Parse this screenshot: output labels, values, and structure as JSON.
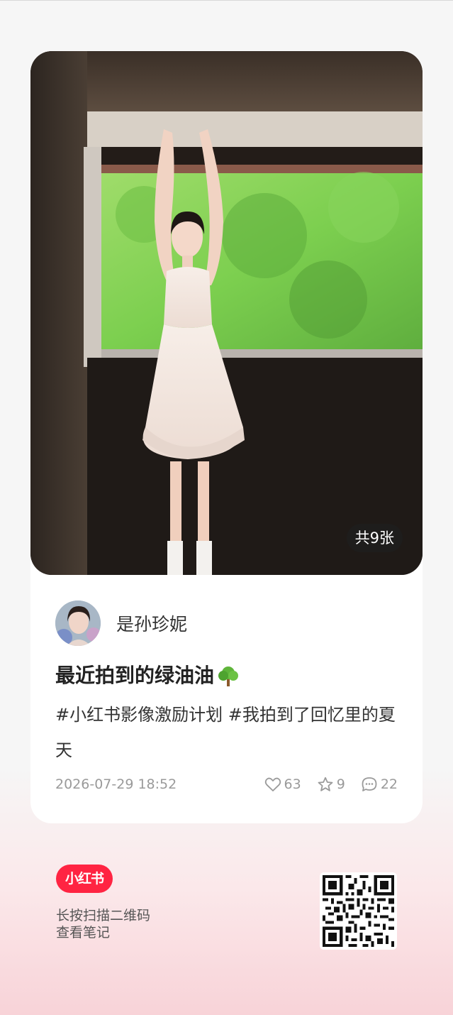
{
  "photo": {
    "image_count_label": "共9张"
  },
  "author": {
    "name": "是孙珍妮"
  },
  "note": {
    "title": "最近拍到的绿油油",
    "title_emoji": "tree-icon",
    "body": "#小红书影像激励计划 #我拍到了回忆里的夏天",
    "date": "2026-07-29 18:52",
    "likes": "63",
    "collects": "9",
    "comments": "22"
  },
  "footer": {
    "logo_text": "小红书",
    "hint_line1": "长按扫描二维码",
    "hint_line2": "查看笔记"
  },
  "colors": {
    "brand": "#ff2442",
    "background_top": "#f6f6f6",
    "background_bottom": "#f8d3d8"
  }
}
